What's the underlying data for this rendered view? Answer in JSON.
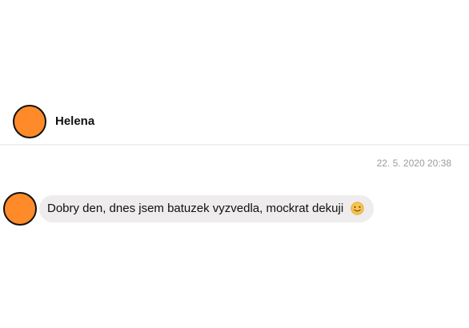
{
  "colors": {
    "avatar_fill": "#ff8a2a",
    "bubble_bg": "#eeecec",
    "timestamp_text": "#9b9b9b"
  },
  "conversation": {
    "contact_name": "Helena",
    "avatar_icon": "avatar-circle-icon"
  },
  "thread": {
    "timestamp": "22. 5. 2020 20:38",
    "messages": [
      {
        "text": "Dobry den, dnes jsem batuzek vyzvedla, mockrat dekuji",
        "emoji_icon": "smiling-face-icon"
      }
    ]
  }
}
